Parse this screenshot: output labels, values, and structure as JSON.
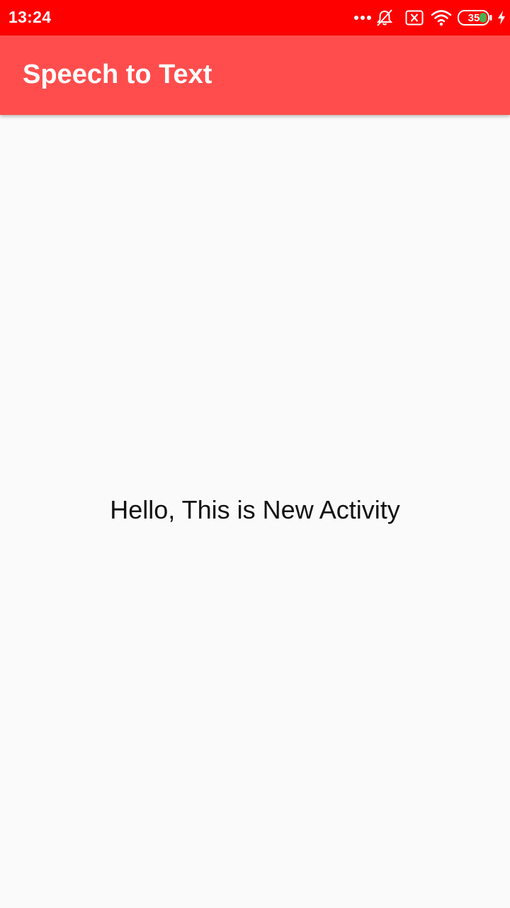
{
  "status_bar": {
    "time": "13:24",
    "battery_level": "35",
    "icons": [
      "more-dots-icon",
      "notifications-off-icon",
      "sim-x-icon",
      "wifi-icon",
      "battery-icon",
      "charging-bolt-icon"
    ],
    "color": "#ff0000"
  },
  "app_bar": {
    "title": "Speech to Text",
    "color": "#ff4d4d"
  },
  "main": {
    "message": "Hello, This is New Activity"
  }
}
